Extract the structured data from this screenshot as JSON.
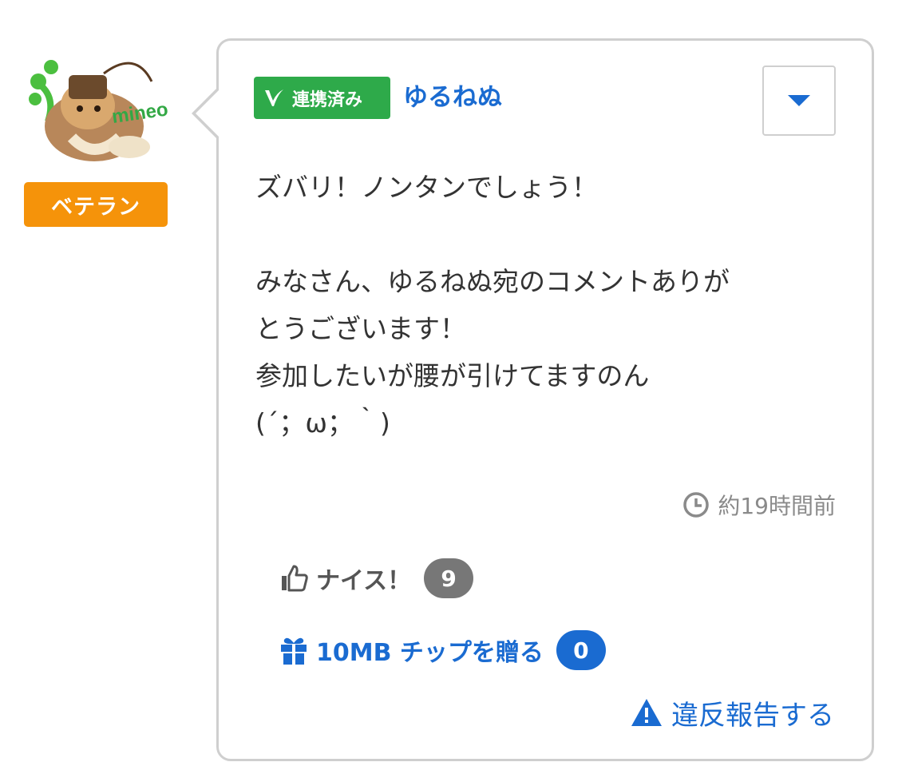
{
  "user": {
    "avatar_icon": "mineo-character-avatar-icon",
    "rank_label": "ベテラン",
    "rank_color": "#f5930a",
    "linked_badge_label": "連携済み",
    "linked_badge_icon": "v-check-icon",
    "linked_badge_color": "#2eaa4a",
    "name": "ゆるねぬ"
  },
  "comment": {
    "lines": [
      "ズバリ！ノンタンでしょう！",
      "",
      "みなさん、ゆるねぬ宛のコメントありが",
      "とうございます！",
      "参加したいが腰が引けてますのん",
      "(´；ω；｀)"
    ],
    "timestamp": "約19時間前",
    "timestamp_icon": "clock-icon"
  },
  "actions": {
    "nice_label": "ナイス！",
    "nice_icon": "thumbs-up-icon",
    "nice_count": "9",
    "tip_label": "10MB チップを贈る",
    "tip_icon": "gift-icon",
    "tip_count": "0",
    "report_label": "違反報告する",
    "report_icon": "warning-icon",
    "menu_icon": "caret-down-icon"
  },
  "colors": {
    "link": "#1a6bd1",
    "border": "#cfcfcf",
    "text": "#333333",
    "muted": "#8a8a8a"
  }
}
